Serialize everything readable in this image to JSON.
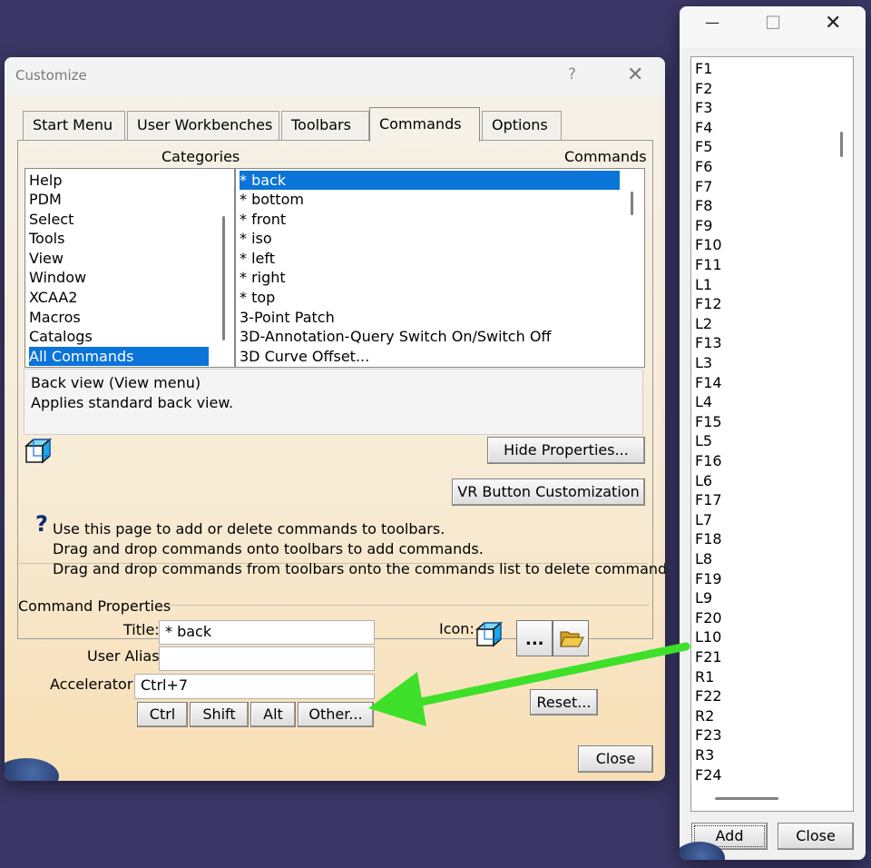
{
  "dialog": {
    "title": "Customize",
    "help_glyph": "?",
    "close_glyph": "✕",
    "tabs": [
      "Start Menu",
      "User Workbenches",
      "Toolbars",
      "Commands",
      "Options"
    ],
    "active_tab": "Commands",
    "categories_label": "Categories",
    "commands_label": "Commands",
    "categories": [
      "Help",
      "PDM",
      "Select",
      "Tools",
      "View",
      "Window",
      "XCAA2",
      "Macros",
      "Catalogs",
      "All Commands"
    ],
    "selected_category": "All Commands",
    "commands": [
      "* back",
      "* bottom",
      "* front",
      "* iso",
      "* left",
      "* right",
      "* top",
      "3-Point Patch",
      "3D-Annotation-Query Switch On/Switch Off",
      "3D Curve Offset..."
    ],
    "selected_command": "* back",
    "description": [
      "Back view (View menu)",
      "Applies standard back view."
    ],
    "hide_properties_label": "Hide Properties...",
    "vr_button_label": "VR Button Customization",
    "help_text": [
      "Use this page to add or delete commands to toolbars.",
      "Drag and drop commands onto toolbars to add commands.",
      "Drag and drop commands from toolbars onto the commands list to delete command."
    ],
    "command_properties": {
      "section_label": "Command Properties",
      "title_label": "Title:",
      "title_value": "* back",
      "alias_label": "User Alias:",
      "alias_value": "",
      "accelerator_label": "Accelerator:",
      "accelerator_value": "Ctrl+7",
      "icon_label": "Icon:",
      "browse_label": "...",
      "modifier_buttons": [
        "Ctrl",
        "Shift",
        "Alt",
        "Other..."
      ],
      "reset_label": "Reset..."
    },
    "close_label": "Close"
  },
  "picker": {
    "minimize_glyph": "—",
    "maximize_glyph": "☐",
    "close_glyph": "✕",
    "keys": [
      "F1",
      "F2",
      "F3",
      "F4",
      "F5",
      "F6",
      "F7",
      "F8",
      "F9",
      "F10",
      "F11",
      "L1",
      "F12",
      "L2",
      "F13",
      "L3",
      "F14",
      "L4",
      "F15",
      "L5",
      "F16",
      "L6",
      "F17",
      "L7",
      "F18",
      "L8",
      "F19",
      "L9",
      "F20",
      "L10",
      "F21",
      "R1",
      "F22",
      "R2",
      "F23",
      "R3",
      "F24"
    ],
    "add_label": "Add",
    "close_label": "Close"
  },
  "colors": {
    "selection": "#0a74d8",
    "annotation_arrow": "#3ee02a",
    "desktop": "#3a3766"
  }
}
